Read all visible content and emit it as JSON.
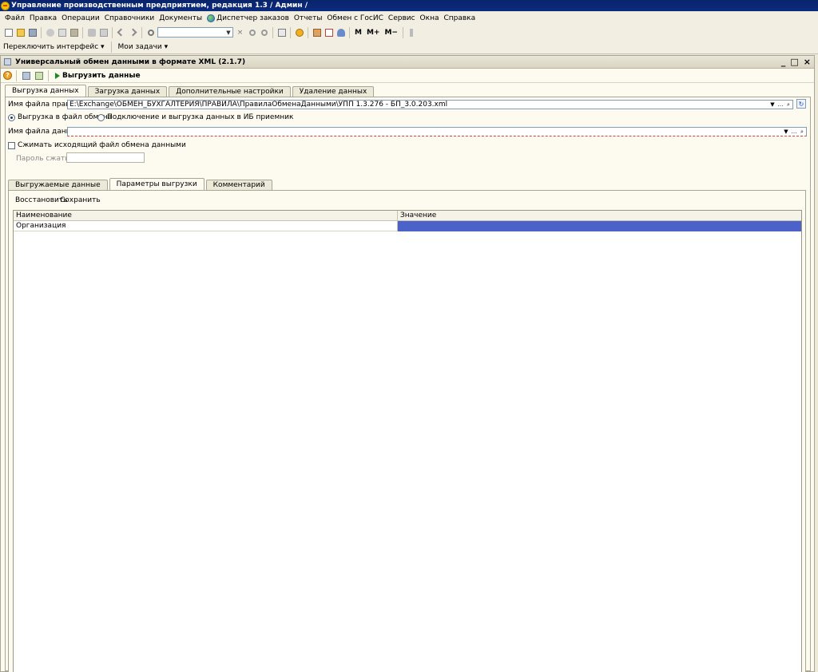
{
  "app": {
    "title": "Управление производственным предприятием, редакция 1.3 / Админ /"
  },
  "menu": [
    "Файл",
    "Правка",
    "Операции",
    "Справочники",
    "Документы",
    "Диспетчер заказов",
    "Отчеты",
    "Обмен с ГосИС",
    "Сервис",
    "Окна",
    "Справка"
  ],
  "toolbar": {
    "search_value": "",
    "m_label": "M",
    "m_plus_label": "M+",
    "m_minus_label": "M−"
  },
  "switchbar": {
    "interface_label": "Переключить интерфейс",
    "tasks_label": "Мои задачи"
  },
  "document": {
    "title": "Универсальный обмен данными в формате XML (2.1.7)",
    "upload_button": "Выгрузить данные",
    "window_buttons": [
      "_",
      "□",
      "×"
    ]
  },
  "main_tabs": [
    "Выгрузка данных",
    "Загрузка данных",
    "Дополнительные настройки",
    "Удаление данных"
  ],
  "form": {
    "rules_label": "Имя файла правил:",
    "rules_value": "E:\\Exchange\\ОБМЕН_БУХГАЛТЕРИЯ\\ПРАВИЛА\\ПравилаОбменаДанными\\УПП 1.3.276 - БП_3.0.203.xml",
    "radio_file": "Выгрузка в файл обмена",
    "radio_connect": "Подключение и выгрузка данных в ИБ приемник",
    "data_file_label": "Имя файла данных:",
    "data_file_value": "",
    "compress_label": "Сжимать исходящий файл обмена данными",
    "password_label": "Пароль сжатия:",
    "password_value": ""
  },
  "sub_tabs": [
    "Выгружаемые данные",
    "Параметры выгрузки",
    "Комментарий"
  ],
  "params": {
    "restore_label": "Восстановить",
    "save_label": "Сохранить",
    "columns": [
      "Наименование",
      "Значение"
    ],
    "rows": [
      {
        "name": "Организация",
        "value": ""
      }
    ]
  },
  "colors": {
    "title_bar": "#0a246a",
    "selection": "#4b63c9",
    "background": "#ece9d8"
  }
}
